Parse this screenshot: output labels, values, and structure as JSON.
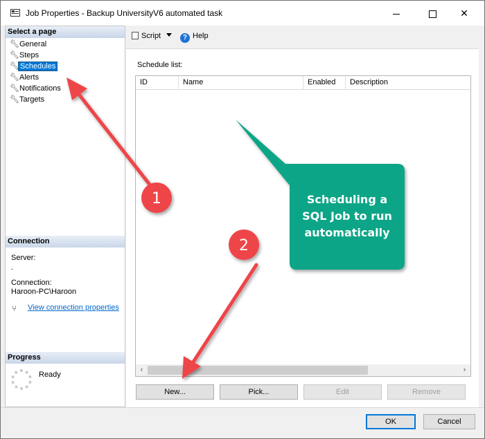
{
  "window": {
    "title": "Job Properties - Backup UniversityV6 automated task",
    "icon": "window-app-icon",
    "controls": [
      "minimize",
      "maximize",
      "close"
    ]
  },
  "left_pane": {
    "select_page_header": "Select a page",
    "pages": [
      {
        "label": "General",
        "icon": "wrench-icon",
        "selected": false
      },
      {
        "label": "Steps",
        "icon": "wrench-icon",
        "selected": false
      },
      {
        "label": "Schedules",
        "icon": "wrench-icon",
        "selected": true
      },
      {
        "label": "Alerts",
        "icon": "wrench-icon",
        "selected": false
      },
      {
        "label": "Notifications",
        "icon": "wrench-icon",
        "selected": false
      },
      {
        "label": "Targets",
        "icon": "wrench-icon",
        "selected": false
      }
    ],
    "connection_header": "Connection",
    "server_label": "Server:",
    "server_value": ".",
    "connection_label": "Connection:",
    "connection_value": "Haroon-PC\\Haroon",
    "view_connection_link": "View connection properties",
    "progress_header": "Progress",
    "progress_status": "Ready"
  },
  "toolbar": {
    "script_label": "Script",
    "help_label": "Help"
  },
  "schedules": {
    "list_label": "Schedule list:",
    "columns": [
      "ID",
      "Name",
      "Enabled",
      "Description"
    ],
    "rows": [],
    "buttons": {
      "new": "New...",
      "pick": "Pick...",
      "edit": "Edit",
      "remove": "Remove"
    }
  },
  "footer": {
    "ok": "OK",
    "cancel": "Cancel"
  },
  "annotations": {
    "callout_line1": "Scheduling a",
    "callout_line2": "SQL Job to run",
    "callout_line3": "automatically",
    "callout_color": "#0aa587",
    "arrow_color": "#ee4548",
    "badge_1": "1",
    "badge_2": "2"
  }
}
